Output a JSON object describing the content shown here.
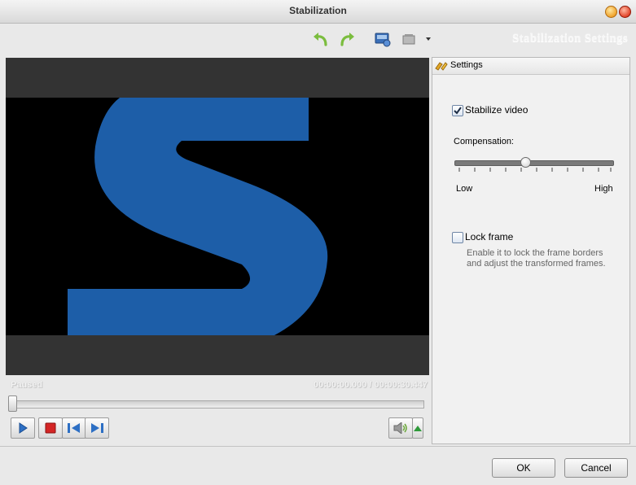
{
  "window": {
    "title": "Stabilization"
  },
  "toolbar": {
    "heading": "Stabilization Settings",
    "icons": [
      "undo-icon",
      "redo-icon",
      "snapshot-icon",
      "film-icon",
      "dropdown-arrow-icon"
    ]
  },
  "player": {
    "status": "Paused",
    "current_time": "00:00:00.000",
    "time_separator": "/",
    "total_time": "00:00:30.447",
    "seek_position": 0
  },
  "settings": {
    "tab_label": "Settings",
    "stabilize_label": "Stabilize video",
    "stabilize_checked": true,
    "compensation_label": "Compensation:",
    "compensation_value": 0.45,
    "low_label": "Low",
    "high_label": "High",
    "lock_label": "Lock frame",
    "lock_checked": false,
    "lock_desc_1": "Enable it to lock the frame borders",
    "lock_desc_2": "and adjust the transformed frames."
  },
  "buttons": {
    "ok": "OK",
    "cancel": "Cancel"
  },
  "colors": {
    "accent_blue": "#1d5ea8",
    "video_bg": "#000000",
    "frame_bg": "#333333"
  }
}
